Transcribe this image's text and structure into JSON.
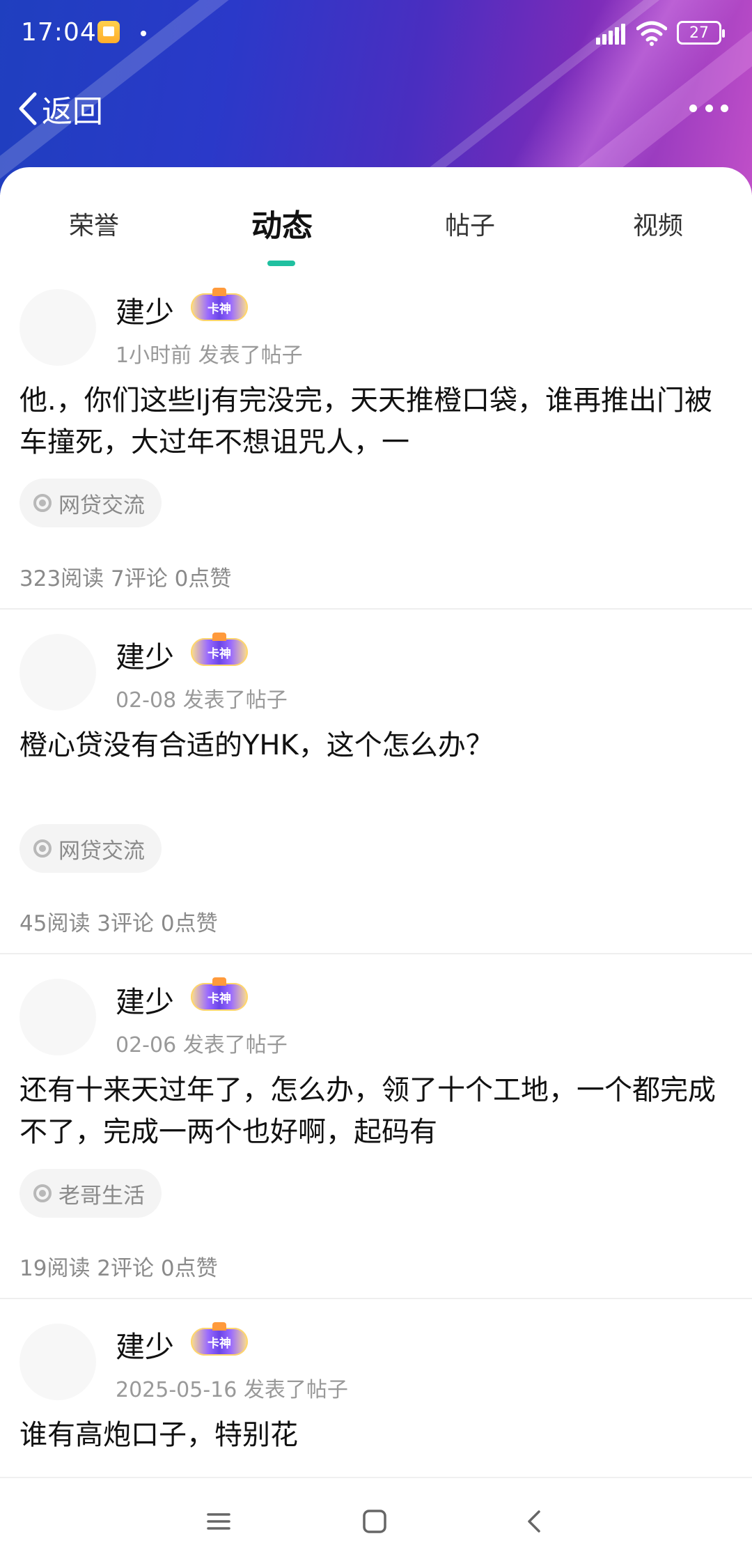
{
  "status_bar": {
    "time": "17:04",
    "battery": "27",
    "icons": [
      "notes-icon",
      "signal-icon",
      "wifi-icon",
      "battery-icon"
    ]
  },
  "nav": {
    "back_label": "返回",
    "back_icon": "chevron-left-icon",
    "more_icon": "more-dots-icon"
  },
  "tabs": [
    {
      "label": "荣誉",
      "active": false
    },
    {
      "label": "动态",
      "active": true
    },
    {
      "label": "帖子",
      "active": false
    },
    {
      "label": "视频",
      "active": false
    }
  ],
  "accent_color": "#20c0a0",
  "posts": [
    {
      "username": "建少",
      "badge": "卡神",
      "meta": "1小时前  发表了帖子",
      "content": "他.，你们这些lj有完没完，天天推橙口袋，谁再推出门被车撞死，大过年不想诅咒人，一",
      "topic": "网贷交流",
      "stats": "323阅读  7评论  0点赞"
    },
    {
      "username": "建少",
      "badge": "卡神",
      "meta": "02-08  发表了帖子",
      "content": "橙心贷没有合适的YHK，这个怎么办？",
      "topic": "网贷交流",
      "stats": "45阅读  3评论  0点赞"
    },
    {
      "username": "建少",
      "badge": "卡神",
      "meta": "02-06  发表了帖子",
      "content": "还有十来天过年了，怎么办，领了十个工地，一个都完成不了，完成一两个也好啊，起码有",
      "topic": "老哥生活",
      "stats": "19阅读  2评论  0点赞"
    },
    {
      "username": "建少",
      "badge": "卡神",
      "meta": "2025-05-16  发表了帖子",
      "content": "谁有高炮口子，特别花"
    }
  ],
  "bottom_nav": {
    "icons": [
      "menu-icon",
      "home-square-icon",
      "back-triangle-icon"
    ]
  }
}
